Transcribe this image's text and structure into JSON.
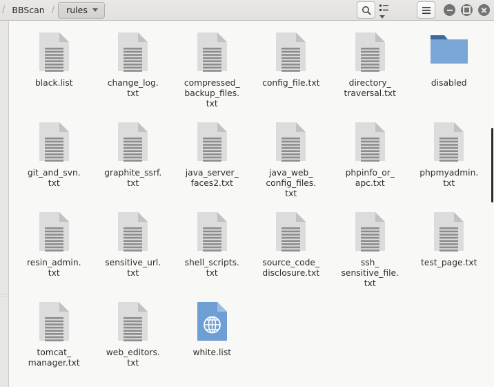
{
  "window": {
    "breadcrumb": {
      "separator": "/",
      "root_label": "BBScan",
      "current_label": "rules"
    },
    "toolbar": {
      "search_icon": "search-icon",
      "view_icon": "list-view-icon",
      "view_chevron_icon": "chevron-down-icon",
      "menu_icon": "hamburger-menu-icon"
    },
    "controls": {
      "minimize_label": "Minimize",
      "maximize_label": "Maximize",
      "close_label": "Close"
    }
  },
  "colors": {
    "titlebar_bg": "#e6e5e3",
    "content_bg": "#f8f8f7",
    "sidebar_bg": "#e7e6e4",
    "text_file_page": "#dcdcdc",
    "text_file_lines": "#8c8c8c",
    "folder_tab": "#3d6a9e",
    "folder_body": "#7ba7d7",
    "web_file": "#6e9ed4",
    "scrollbar_thumb": "#2b2b2b",
    "label_text": "#2e2e2e"
  },
  "files": [
    {
      "name": "black.list",
      "label": "black.list",
      "icon": "text-file-icon",
      "type": "text"
    },
    {
      "name": "change_log.txt",
      "label": "change_log.\ntxt",
      "icon": "text-file-icon",
      "type": "text"
    },
    {
      "name": "compressed_backup_files.txt",
      "label": "compressed_\nbackup_files.\ntxt",
      "icon": "text-file-icon",
      "type": "text"
    },
    {
      "name": "config_file.txt",
      "label": "config_file.txt",
      "icon": "text-file-icon",
      "type": "text"
    },
    {
      "name": "directory_traversal.txt",
      "label": "directory_\ntraversal.txt",
      "icon": "text-file-icon",
      "type": "text"
    },
    {
      "name": "disabled",
      "label": "disabled",
      "icon": "folder-icon",
      "type": "folder"
    },
    {
      "name": "git_and_svn.txt",
      "label": "git_and_svn.\ntxt",
      "icon": "text-file-icon",
      "type": "text"
    },
    {
      "name": "graphite_ssrf.txt",
      "label": "graphite_ssrf.\ntxt",
      "icon": "text-file-icon",
      "type": "text"
    },
    {
      "name": "java_server_faces2.txt",
      "label": "java_server_\nfaces2.txt",
      "icon": "text-file-icon",
      "type": "text"
    },
    {
      "name": "java_web_config_files.txt",
      "label": "java_web_\nconfig_files.\ntxt",
      "icon": "text-file-icon",
      "type": "text"
    },
    {
      "name": "phpinfo_or_apc.txt",
      "label": "phpinfo_or_\napc.txt",
      "icon": "text-file-icon",
      "type": "text"
    },
    {
      "name": "phpmyadmin.txt",
      "label": "phpmyadmin.\ntxt",
      "icon": "text-file-icon",
      "type": "text"
    },
    {
      "name": "resin_admin.txt",
      "label": "resin_admin.\ntxt",
      "icon": "text-file-icon",
      "type": "text"
    },
    {
      "name": "sensitive_url.txt",
      "label": "sensitive_url.\ntxt",
      "icon": "text-file-icon",
      "type": "text"
    },
    {
      "name": "shell_scripts.txt",
      "label": "shell_scripts.\ntxt",
      "icon": "text-file-icon",
      "type": "text"
    },
    {
      "name": "source_code_disclosure.txt",
      "label": "source_code_\ndisclosure.txt",
      "icon": "text-file-icon",
      "type": "text"
    },
    {
      "name": "ssh_sensitive_file.txt",
      "label": "ssh_\nsensitive_file.\ntxt",
      "icon": "text-file-icon",
      "type": "text"
    },
    {
      "name": "test_page.txt",
      "label": "test_page.txt",
      "icon": "text-file-icon",
      "type": "text"
    },
    {
      "name": "tomcat_manager.txt",
      "label": "tomcat_\nmanager.txt",
      "icon": "text-file-icon",
      "type": "text"
    },
    {
      "name": "web_editors.txt",
      "label": "web_editors.\ntxt",
      "icon": "text-file-icon",
      "type": "text"
    },
    {
      "name": "white.list",
      "label": "white.list",
      "icon": "web-file-icon",
      "type": "web"
    }
  ]
}
